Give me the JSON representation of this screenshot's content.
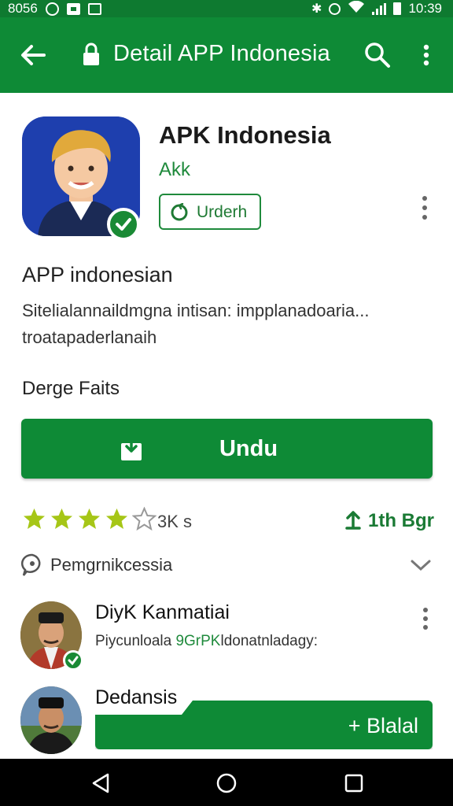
{
  "status_bar": {
    "left_text": "8056",
    "time": "10:39",
    "icons": [
      "instagram-icon",
      "gallery-icon",
      "message-icon",
      "bluetooth-icon",
      "alarm-icon",
      "wifi-icon",
      "signal-icon",
      "battery-icon"
    ]
  },
  "app_bar": {
    "title": "Detail APP Indonesia",
    "background": "#0e8a36",
    "icons": [
      "back-arrow-icon",
      "lock-icon",
      "search-icon",
      "more-vert-icon"
    ]
  },
  "app": {
    "name": "APK Indonesia",
    "developer": "Akk",
    "update_chip_label": "Urderh",
    "verified_icon": "check-badge-icon"
  },
  "about": {
    "title": "APP indonesian",
    "description_lines": [
      "Sitelialannaildmgna intisan: impplanadoaria...",
      "troatapaderlanaih"
    ]
  },
  "subheading": "Derge Faits",
  "install_button": {
    "label": "Undu",
    "icon": "download-package-icon",
    "color": "#0e8a36"
  },
  "rating": {
    "stars_value": 4,
    "stars_max": 5,
    "star_color": "#a6c617",
    "count_text": "3K s",
    "rank_text": "1th Bgr",
    "rank_icon": "upload-arrow-icon"
  },
  "reviews_header": {
    "label": "Pemgrnikcessia",
    "icon": "chat-bubble-icon",
    "chevron": "chevron-down-icon"
  },
  "reviews": [
    {
      "name": "DiyK Kanmatiai",
      "text_before": "Piycunloala",
      "text_highlight": " 9GrPK",
      "text_after": "ldonatnladagy:",
      "verified": true
    },
    {
      "name": "Dedansis",
      "text_before": "",
      "text_highlight": "",
      "text_after": "",
      "verified": false
    }
  ],
  "share_button": {
    "label": "+ Blalal"
  },
  "nav_bar": {
    "icons": [
      "nav-back-icon",
      "nav-home-icon",
      "nav-recents-icon"
    ]
  }
}
